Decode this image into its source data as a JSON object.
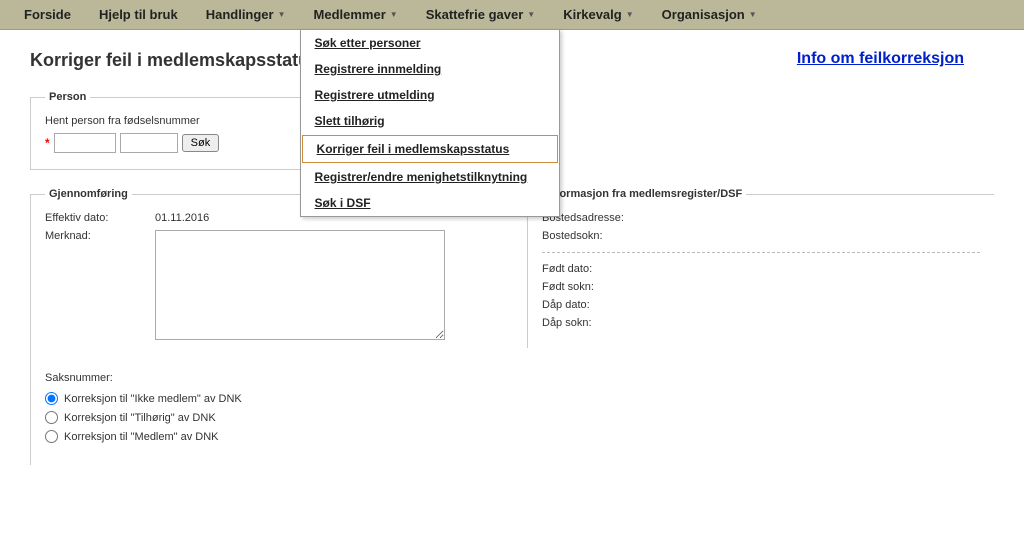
{
  "menu": {
    "items": [
      "Forside",
      "Hjelp til bruk",
      "Handlinger",
      "Medlemmer",
      "Skattefrie gaver",
      "Kirkevalg",
      "Organisasjon"
    ],
    "has_dropdown": [
      false,
      false,
      true,
      true,
      true,
      true,
      true
    ],
    "open_index": 3
  },
  "dropdown": {
    "items": [
      "Søk etter personer",
      "Registrere innmelding",
      "Registrere utmelding",
      "Slett tilhørig",
      "Korriger feil i medlemskapsstatus",
      "Registrer/endre menighetstilknytning",
      "Søk i DSF"
    ],
    "highlight_index": 4
  },
  "page": {
    "title": "Korriger feil i medlemskapsstatus",
    "info_link": "Info om feilkorreksjon"
  },
  "person": {
    "legend": "Person",
    "hint": "Hent person fra fødselsnummer",
    "field1": "",
    "field2": "",
    "search_btn": "Søk"
  },
  "gjennom": {
    "legend": "Gjennomføring",
    "eff_label": "Effektiv dato:",
    "eff_value": "01.11.2016",
    "merknad_label": "Merknad:",
    "merknad_value": "",
    "saks_label": "Saksnummer:",
    "radios": [
      "Korreksjon til \"Ikke medlem\" av DNK",
      "Korreksjon til \"Tilhørig\" av DNK",
      "Korreksjon til \"Medlem\" av DNK"
    ],
    "radio_selected": 0
  },
  "info": {
    "legend": "Informasjon fra medlemsregister/DSF",
    "rows1": [
      "Bostedsadresse:",
      "Bostedsokn:"
    ],
    "rows2": [
      "Født dato:",
      "Født sokn:",
      "Dåp dato:",
      "Dåp sokn:"
    ]
  }
}
